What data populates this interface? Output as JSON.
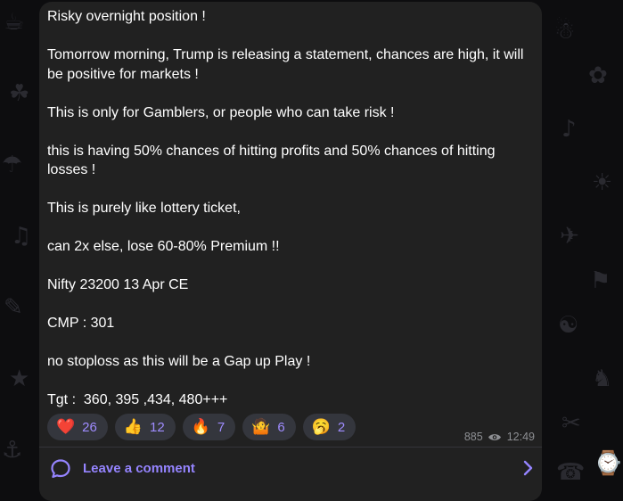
{
  "wallpaper": [
    "☕",
    "☘",
    "☂",
    "♫",
    "✎",
    "★",
    "⚓",
    "☃",
    "✿",
    "♪",
    "☀",
    "✈",
    "⚑",
    "☯",
    "♞",
    "✂",
    "⌚",
    "☎"
  ],
  "message": {
    "paragraphs": [
      "Risky overnight position !",
      "Tomorrow morning, Trump is releasing a statement, chances are high, it will be positive for markets !",
      "This is only for Gamblers, or people who can take risk !",
      "this is having 50% chances of hitting profits and 50% chances of hitting losses !",
      "This is purely like lottery ticket,",
      "can 2x else, lose 60-80% Premium !!",
      "Nifty 23200 13 Apr CE",
      "CMP : 301",
      "no stoploss as this will be a Gap up Play !",
      "Tgt :  360, 395 ,434, 480+++"
    ],
    "reactions": [
      {
        "emoji": "❤️",
        "name": "heart",
        "count": "26"
      },
      {
        "emoji": "👍",
        "name": "thumbs-up",
        "count": "12"
      },
      {
        "emoji": "🔥",
        "name": "fire",
        "count": "7"
      },
      {
        "emoji": "🤷",
        "name": "shrug",
        "count": "6"
      },
      {
        "emoji": "🥱",
        "name": "yawning-face",
        "count": "2"
      }
    ],
    "views": "885",
    "time": "12:49"
  },
  "comment": {
    "label": "Leave a comment"
  },
  "colors": {
    "accent": "#9584ff",
    "bubble": "#212121",
    "background": "#0d0d0f"
  }
}
